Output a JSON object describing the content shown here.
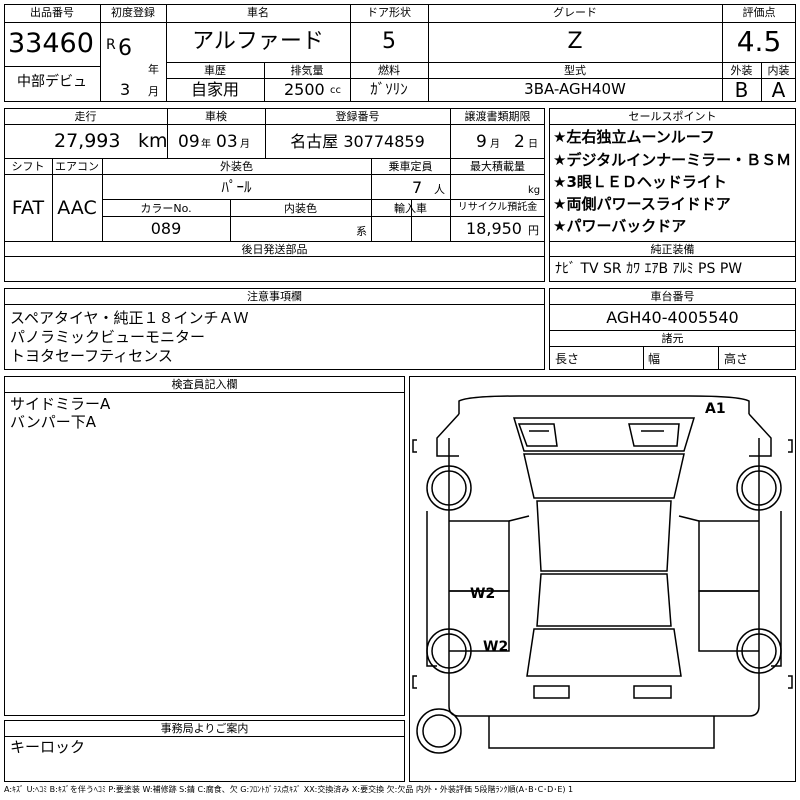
{
  "header": {
    "lot_label": "出品番号",
    "lot_number": "33460",
    "debut_label": "中部デビュ",
    "first_reg_label": "初度登録",
    "era_mark": "R",
    "reg_year": "6",
    "year_unit": "年",
    "reg_month": "3",
    "month_unit": "月",
    "car_name_label": "車名",
    "car_name": "アルファード",
    "door_label": "ドア形状",
    "doors": "5",
    "grade_label": "グレード",
    "grade": "Z",
    "score_label": "評価点",
    "score": "4.5",
    "history_label": "車歴",
    "history": "自家用",
    "displacement_label": "排気量",
    "displacement": "2500",
    "displacement_unit": "cc",
    "fuel_label": "燃料",
    "fuel": "ｶﾞｿﾘﾝ",
    "model_label": "型式",
    "model": "3BA-AGH40W",
    "exterior_label": "外装",
    "exterior_grade": "B",
    "interior_label": "内装",
    "interior_grade": "A"
  },
  "details": {
    "mileage_label": "走行",
    "mileage": "27,993",
    "mileage_unit": "km",
    "inspection_label": "車検",
    "inspection_year": "09",
    "inspection_year_unit": "年",
    "inspection_month": "03",
    "inspection_month_unit": "月",
    "plate_label": "登録番号",
    "plate": "名古屋 30774859",
    "transfer_label": "譲渡書類期限",
    "transfer_month": "9",
    "transfer_month_unit": "月",
    "transfer_day": "2",
    "transfer_day_unit": "日",
    "shift_label": "シフト",
    "shift": "FAT",
    "ac_label": "エアコン",
    "ac": "AAC",
    "color_label": "外装色",
    "color": "ﾊﾟｰﾙ",
    "capacity_label": "乗車定員",
    "capacity": "7",
    "capacity_unit": "人",
    "load_label": "最大積載量",
    "load_unit": "kg",
    "color_no_label": "カラーNo.",
    "color_no": "089",
    "interior_color_label": "内装色",
    "interior_color_suffix": "系",
    "import_label": "輸入車",
    "recycle_label": "リサイクル預託金",
    "recycle": "18,950",
    "recycle_unit": "円",
    "later_label": "後日発送部品"
  },
  "sales_points": {
    "title": "セールスポイント",
    "items": [
      "★左右独立ムーンルーフ",
      "★デジタルインナーミラー・ＢＳＭ",
      "★3眼ＬＥＤヘッドライト",
      "★両側パワースライドドア",
      "★パワーバックドア"
    ],
    "equipment_label": "純正装備",
    "equipment": "ﾅﾋﾞ TV SR ｶﾜ ｴｱB ｱﾙﾐ PS PW"
  },
  "notes": {
    "title": "注意事項欄",
    "lines": [
      "スペアタイヤ・純正１８インチＡＷ",
      "パノラミックビューモニター",
      "トヨタセーフティセンス"
    ]
  },
  "chassis": {
    "title": "車台番号",
    "number": "AGH40-4005540",
    "dims_label": "諸元",
    "length_label": "長さ",
    "width_label": "幅",
    "height_label": "高さ"
  },
  "inspector": {
    "title": "検査員記入欄",
    "lines": [
      "サイドミラーA",
      "バンパー下A"
    ]
  },
  "office": {
    "title": "事務局よりご案内",
    "text": "キーロック"
  },
  "diagram": {
    "marks": [
      "A1",
      "W2",
      "W2"
    ]
  },
  "legend": "A:ｷｽﾞ U:ﾍｺﾐ B:ｷｽﾞを伴うﾍｺﾐ P:要塗装 W:補修跡 S:錆 C:腐食、欠 G:ﾌﾛﾝﾄｶﾞﾗｽ点ｷｽﾞ XX:交換済み X:要交換 欠:欠品 内外・外装評価 5段階ﾗﾝｸ順(A･B･C･D･E) 1"
}
